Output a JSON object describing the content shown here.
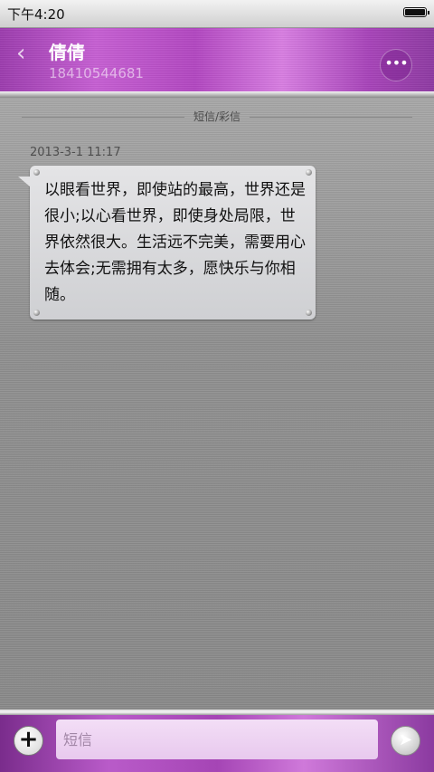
{
  "status_bar": {
    "time": "下午4:20",
    "battery_level": 1.0
  },
  "header": {
    "back_icon": "chevron-left-icon",
    "contact_name": "倩倩",
    "contact_number": "18410544681",
    "more_icon": "ellipsis-icon",
    "more_glyph": "•••"
  },
  "thread": {
    "label": "短信/彩信",
    "messages": [
      {
        "timestamp": "2013-3-1 11:17",
        "direction": "incoming",
        "text": "以眼看世界，即使站的最高，世界还是很小;以心看世界，即使身处局限，世界依然很大。生活远不完美，需要用心去体会;无需拥有太多，愿快乐与你相随。"
      }
    ]
  },
  "input_bar": {
    "add_icon": "plus-icon",
    "add_glyph": "+",
    "placeholder": "短信",
    "value": "",
    "send_icon": "send-arrow-icon",
    "send_glyph": "➤"
  },
  "colors": {
    "accent_purple": "#b247c1",
    "bubble": "#dcdcde",
    "background": "#8d8d8d"
  }
}
